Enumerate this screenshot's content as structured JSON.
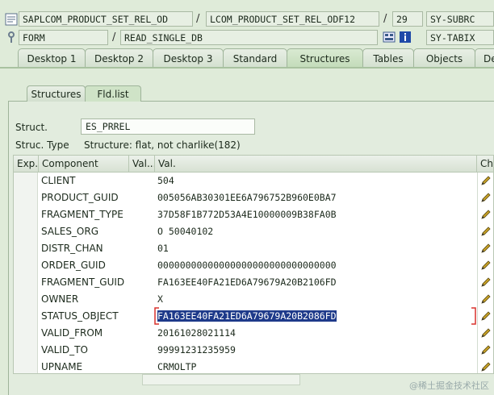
{
  "header": {
    "row1": {
      "program": "SAPLCOM_PRODUCT_SET_REL_OD",
      "include": "LCOM_PRODUCT_SET_REL_ODF12",
      "line": "29",
      "sysvar": "SY-SUBRC"
    },
    "row2": {
      "event_type": "FORM",
      "event_name": "READ_SINGLE_DB",
      "sysvar": "SY-TABIX"
    }
  },
  "tabs": [
    "Desktop 1",
    "Desktop 2",
    "Desktop 3",
    "Standard",
    "Structures",
    "Tables",
    "Objects",
    "Detail"
  ],
  "active_tab": "Structures",
  "inner_tabs": [
    "Structures",
    "Fld.list"
  ],
  "active_inner_tab": "Fld.list",
  "struct": {
    "struct_label": "Struct.",
    "struct_value": "ES_PRREL",
    "type_label": "Struc. Type",
    "type_value": "Structure: flat, not charlike(182)"
  },
  "grid": {
    "headers": {
      "exp": "Exp.",
      "component": "Component",
      "valshort": "Val...",
      "val": "Val.",
      "change": "Ch..."
    },
    "rows": [
      {
        "component": "CLIENT",
        "value": "504"
      },
      {
        "component": "PRODUCT_GUID",
        "value": "005056AB30301EE6A796752B960E0BA7"
      },
      {
        "component": "FRAGMENT_TYPE",
        "value": "37D58F1B772D53A4E10000009B38FA0B"
      },
      {
        "component": "SALES_ORG",
        "value": "O 50040102"
      },
      {
        "component": "DISTR_CHAN",
        "value": "01"
      },
      {
        "component": "ORDER_GUID",
        "value": "00000000000000000000000000000000"
      },
      {
        "component": "FRAGMENT_GUID",
        "value": "FA163EE40FA21ED6A79679A20B2106FD"
      },
      {
        "component": "OWNER",
        "value": "X"
      },
      {
        "component": "STATUS_OBJECT",
        "value": "FA163EE40FA21ED6A79679A20B2086FD"
      },
      {
        "component": "VALID_FROM",
        "value": "20161028021114"
      },
      {
        "component": "VALID_TO",
        "value": "99991231235959"
      },
      {
        "component": "UPNAME",
        "value": "CRMOLTP"
      }
    ],
    "selected_row": 8
  },
  "watermark": "@稀土掘金技术社区",
  "colors": {
    "selection": "#1e3a8a",
    "background": "#dfebd9",
    "pencil": "#c9a227"
  }
}
